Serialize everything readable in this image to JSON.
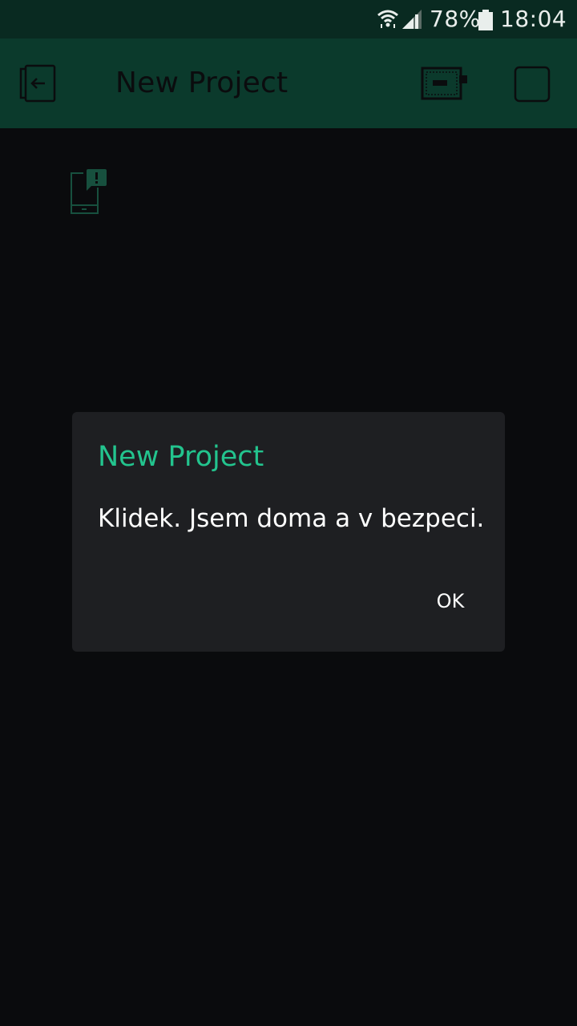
{
  "status_bar": {
    "battery_percent": "78%",
    "time": "18:04",
    "icons": [
      "wifi-icon",
      "cell-signal-icon",
      "battery-icon"
    ]
  },
  "app_bar": {
    "title": "New Project",
    "icons": [
      "exit-project-icon",
      "device-icon",
      "stop-icon"
    ]
  },
  "canvas": {
    "widgets": [
      {
        "icon": "notification-widget-icon"
      }
    ]
  },
  "dialog": {
    "title": "New Project",
    "message": "Klidek. Jsem doma a v bezpeci.",
    "ok_label": "OK"
  },
  "colors": {
    "status_bar_bg": "#092a21",
    "app_bar_bg": "#0b3a2c",
    "canvas_bg": "#0a0b0d",
    "dialog_bg": "#1e1f22",
    "accent": "#23c48e"
  }
}
